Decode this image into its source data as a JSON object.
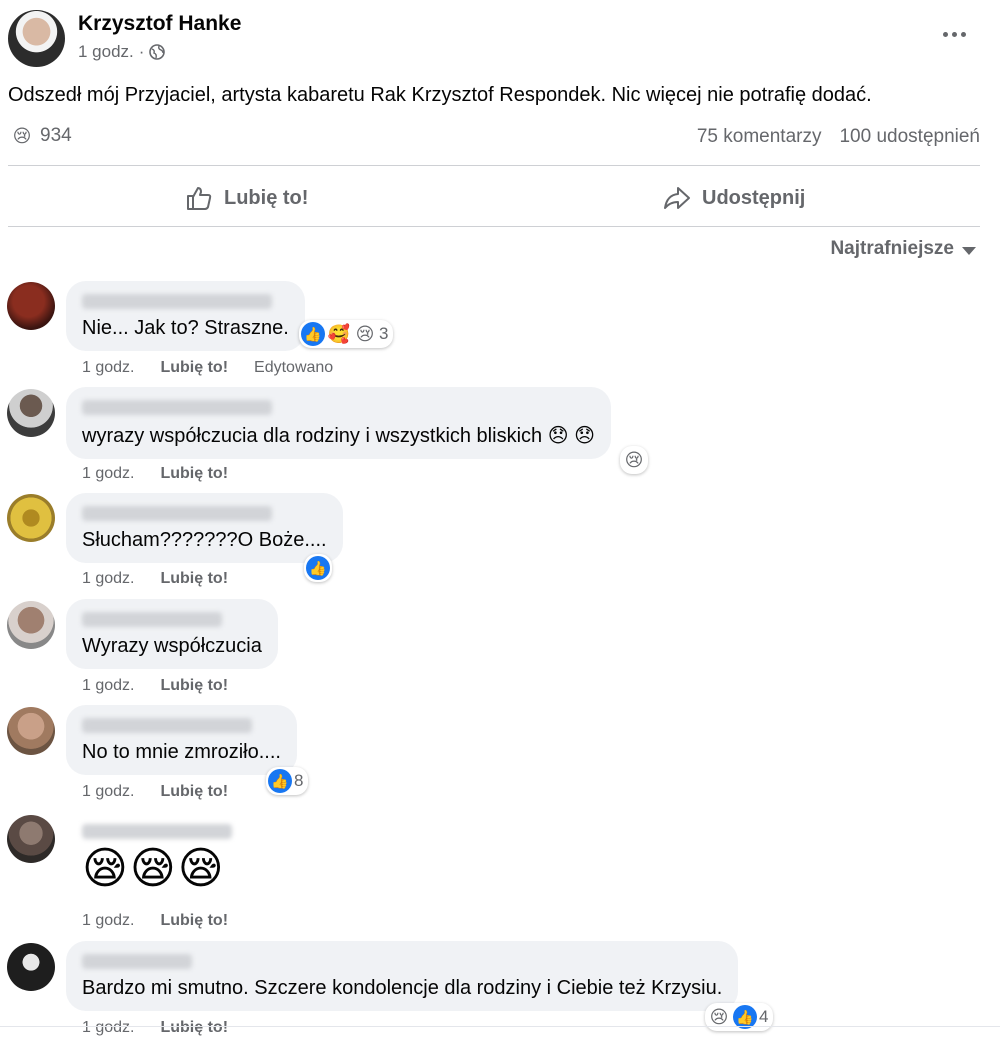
{
  "post": {
    "author": "Krzysztof Hanke",
    "time": "1 godz.",
    "separator": "·",
    "text": "Odszedł mój Przyjaciel, artysta  kabaretu Rak Krzysztof Respondek. Nic więcej nie potrafię dodać.",
    "reaction_icon": "sad-emoji",
    "reaction_emoji": "😢",
    "reaction_count": "934",
    "comments_count": "75 komentarzy",
    "shares_count": "100 udostępnień"
  },
  "actions": {
    "like_label": "Lubię to!",
    "share_label": "Udostępnij"
  },
  "sort": {
    "label": "Najtrafniejsze"
  },
  "comments": [
    {
      "text": "Nie... Jak to? Straszne.",
      "time": "1 godz.",
      "like": "Lubię to!",
      "edited": "Edytowano",
      "reactions": [
        "👍",
        "🥰",
        "😢"
      ],
      "reaction_count": "3"
    },
    {
      "text": "wyrazy współczucia dla rodziny i wszystkich bliskich 😞 😞",
      "time": "1 godz.",
      "like": "Lubię to!",
      "reactions": [
        "😢"
      ]
    },
    {
      "text": "Słucham???????O Boże....",
      "time": "1 godz.",
      "like": "Lubię to!",
      "reactions": [
        "👍"
      ]
    },
    {
      "text": "Wyrazy współczucia",
      "time": "1 godz.",
      "like": "Lubię to!"
    },
    {
      "text": "No to mnie zmroziło....",
      "time": "1 godz.",
      "like": "Lubię to!",
      "reactions": [
        "👍"
      ],
      "reaction_count": "8"
    },
    {
      "text": "😪😪😪",
      "time": "1 godz.",
      "like": "Lubię to!"
    },
    {
      "text": "Bardzo mi smutno. Szczere kondolencje dla rodziny i Ciebie też Krzysiu.",
      "time": "1 godz.",
      "like": "Lubię to!",
      "reactions": [
        "😢",
        "👍"
      ],
      "reaction_count": "4"
    }
  ],
  "colors": {
    "secondary_text": "#65676b",
    "bubble_bg": "#f0f2f5",
    "like_blue": "#1877f2",
    "divider": "#ced0d4"
  }
}
